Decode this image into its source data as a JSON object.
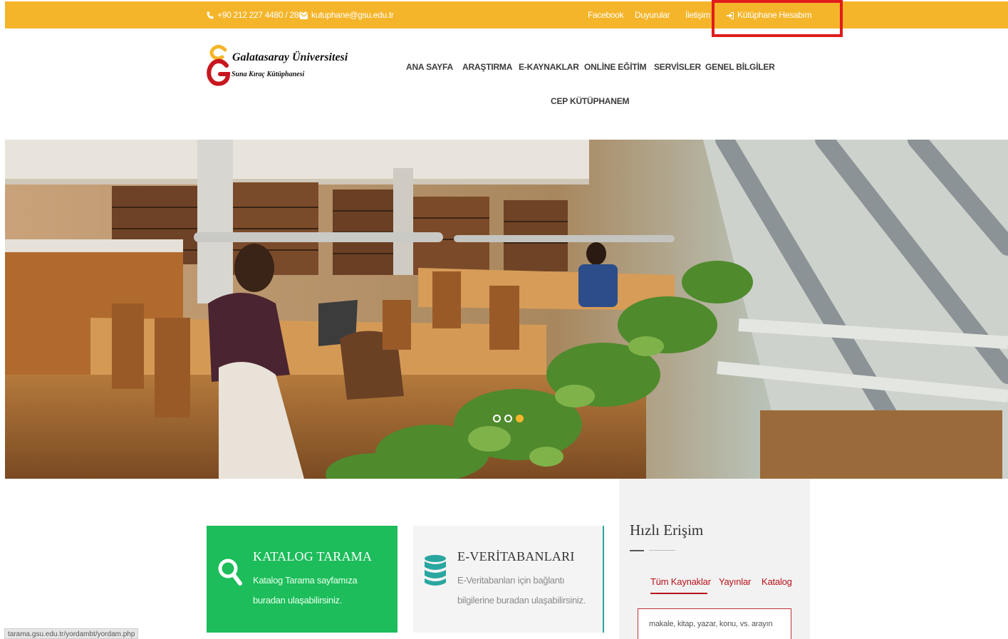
{
  "topbar": {
    "phone": "+90 212 227 4480 / 2800",
    "email": "kutuphane@gsu.edu.tr",
    "links": [
      "Facebook",
      "Duyurular",
      "İletişim"
    ],
    "account": "Kütüphane Hesabım",
    "bg_color": "#f5b52a"
  },
  "logo": {
    "title": "Galatasaray Üniversitesi",
    "subtitle": "Suna Kıraç Kütüphanesi"
  },
  "nav": {
    "items": [
      "ANA SAYFA",
      "ARAŞTIRMA",
      "E-KAYNAKLAR",
      "ONLİNE EĞİTİM",
      "SERVİSLER",
      "GENEL BİLGİLER",
      "CEP KÜTÜPHANEM"
    ]
  },
  "hero": {
    "slide_count": 3,
    "active_slide": 3,
    "active_dot_color": "#f5b52a"
  },
  "cards": [
    {
      "title": "KATALOG TARAMA",
      "description": "Katalog Tarama sayfamıza buradan ulaşabilirsiniz.",
      "icon": "search-icon",
      "color": "#1cbd5a"
    },
    {
      "title": "E-VERİTABANLARI",
      "description": "E-Veritabanları için bağlantı bilgilerine buradan ulaşabilirsiniz.",
      "icon": "database-icon",
      "color": "#2aa6a0"
    }
  ],
  "quick_access": {
    "title": "Hızlı Erişim",
    "tabs": [
      "Tüm Kaynaklar",
      "Yayınlar",
      "Katalog"
    ],
    "active_tab": 0,
    "search_placeholder": "makale, kitap, yazar, konu, vs. arayın",
    "accent_color": "#b8121b"
  },
  "status_bar": {
    "url": "tarama.gsu.edu.tr/yordambt/yordam.php"
  }
}
